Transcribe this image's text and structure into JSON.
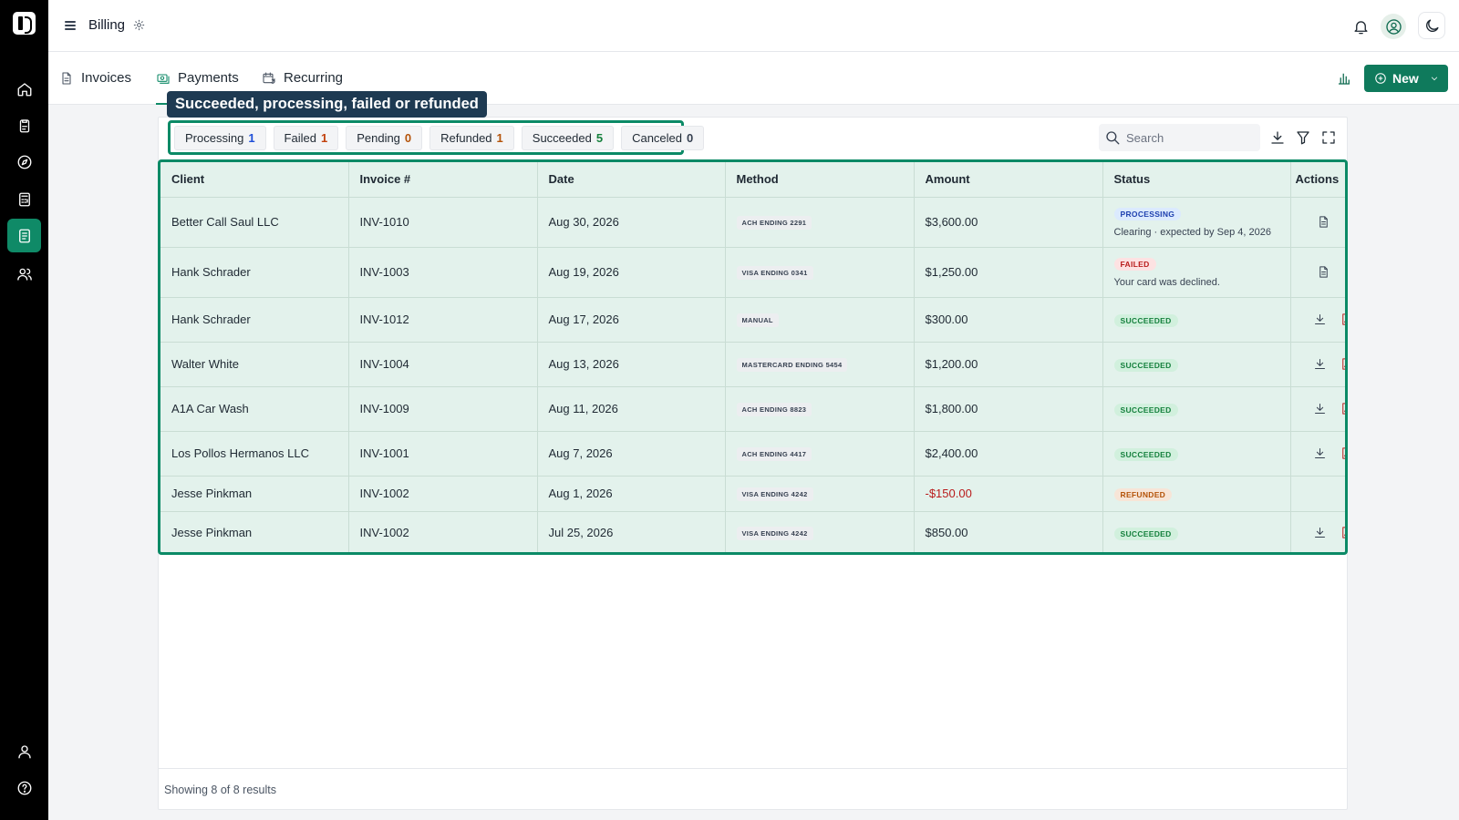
{
  "app": {
    "title": "Billing"
  },
  "tabs": [
    {
      "label": "Invoices",
      "active": false
    },
    {
      "label": "Payments",
      "active": true
    },
    {
      "label": "Recurring",
      "active": false
    }
  ],
  "new_button": {
    "label": "New"
  },
  "tooltip": "Succeeded, processing, failed or refunded",
  "filters": [
    {
      "label": "Processing",
      "count": "1",
      "color": "#1d4ed8"
    },
    {
      "label": "Failed",
      "count": "1",
      "color": "#c2410c"
    },
    {
      "label": "Pending",
      "count": "0",
      "color": "#b45309"
    },
    {
      "label": "Refunded",
      "count": "1",
      "color": "#b45309"
    },
    {
      "label": "Succeeded",
      "count": "5",
      "color": "#15803d"
    },
    {
      "label": "Canceled",
      "count": "0",
      "color": "#374151"
    }
  ],
  "search": {
    "placeholder": "Search"
  },
  "table": {
    "columns": [
      "Client",
      "Invoice #",
      "Date",
      "Method",
      "Amount",
      "Status",
      "Actions"
    ],
    "rows": [
      {
        "client": "Better Call Saul LLC",
        "invoice": "INV-1010",
        "date": "Aug 30, 2026",
        "method": "ACH ENDING 2291",
        "amount": "$3,600.00",
        "status": "PROCESSING",
        "note": "Clearing · expected by Sep 4, 2026"
      },
      {
        "client": "Hank Schrader",
        "invoice": "INV-1003",
        "date": "Aug 19, 2026",
        "method": "VISA ENDING 0341",
        "amount": "$1,250.00",
        "status": "FAILED",
        "note": "Your card was declined."
      },
      {
        "client": "Hank Schrader",
        "invoice": "INV-1012",
        "date": "Aug 17, 2026",
        "method": "MANUAL",
        "amount": "$300.00",
        "status": "SUCCEEDED",
        "note": ""
      },
      {
        "client": "Walter White",
        "invoice": "INV-1004",
        "date": "Aug 13, 2026",
        "method": "MASTERCARD ENDING 5454",
        "amount": "$1,200.00",
        "status": "SUCCEEDED",
        "note": ""
      },
      {
        "client": "A1A Car Wash",
        "invoice": "INV-1009",
        "date": "Aug 11, 2026",
        "method": "ACH ENDING 8823",
        "amount": "$1,800.00",
        "status": "SUCCEEDED",
        "note": ""
      },
      {
        "client": "Los Pollos Hermanos LLC",
        "invoice": "INV-1001",
        "date": "Aug 7, 2026",
        "method": "ACH ENDING 4417",
        "amount": "$2,400.00",
        "status": "SUCCEEDED",
        "note": ""
      },
      {
        "client": "Jesse Pinkman",
        "invoice": "INV-1002",
        "date": "Aug 1, 2026",
        "method": "VISA ENDING 4242",
        "amount": "-$150.00",
        "status": "REFUNDED",
        "note": ""
      },
      {
        "client": "Jesse Pinkman",
        "invoice": "INV-1002",
        "date": "Jul 25, 2026",
        "method": "VISA ENDING 4242",
        "amount": "$850.00",
        "status": "SUCCEEDED",
        "note": ""
      }
    ]
  },
  "footer": {
    "results": "Showing 8 of 8 results"
  },
  "icons": {
    "rail": [
      "home-icon",
      "clipboard-icon",
      "compass-icon",
      "calculator-icon",
      "billing-icon",
      "users-icon",
      "profile-icon",
      "help-icon"
    ],
    "top": [
      "bell-icon",
      "user-circle-icon",
      "moon-icon"
    ]
  },
  "colors": {
    "accent": "#0f8a67",
    "table_bg": "#e3f2ec",
    "tooltip_bg": "#1e3a52"
  }
}
